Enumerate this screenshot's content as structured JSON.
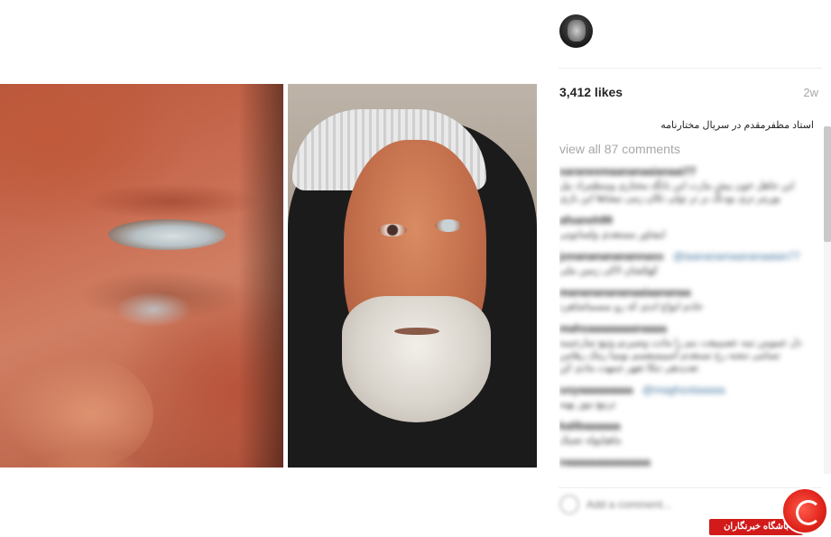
{
  "post": {
    "likes": "3,412 likes",
    "age": "2w",
    "caption": "استاد مظفرمقدم در سریال مختارنامه",
    "view_all_comments": "view all 87 comments",
    "comment_placeholder": "Add a comment..."
  },
  "comments": [
    {
      "user": "saraneemaananaaianaai77",
      "mention": "",
      "text": "این جاهل خون بیش مارت این بانگه مختاری وسطمراد نیل بورینر تری بودنگ بر تر تولی تکان زمی نیشاها این باری"
    },
    {
      "user": "afsaneh99",
      "mention": "",
      "text": "ایشاور مستعدی ولسابونی"
    },
    {
      "user": "jonananananannass",
      "mention": "@iaananamaananaaian77",
      "text": "کهکشان لاکی زمین ملی"
    },
    {
      "user": "manananananaaiaananaa",
      "mention": "",
      "text": "خادم انواع اندی که رو نمسماشاهرد"
    },
    {
      "user": "mahsaaaaaaaanaaaa",
      "mention": "",
      "text": "ذل عمومن تمه عصیبیعت بنم را مانت وصیرنم وتیع تمارجمبه تسامی تنجنه رخ تسنغدم آسیبسفسم بومیا رمک رهامن تعدیدهی تنکا تعهر جمهت مادی کن"
    },
    {
      "user": "uoyaaaaaaaaa",
      "mention": "@maghsotaaaaa",
      "text": "ترنیع نیوز بهبه"
    },
    {
      "user": "kalibaaaaaa",
      "mention": "",
      "text": "ماهیاپوله تصیک"
    },
    {
      "user": "naaaaaaaaaaaaaa",
      "mention": "",
      "text": ""
    }
  ],
  "watermark": {
    "label": "باشگاه خبرنگاران"
  },
  "icons": {
    "avatar": "profile-avatar",
    "heart": "heart-icon",
    "logo": "watermark-logo-icon"
  }
}
